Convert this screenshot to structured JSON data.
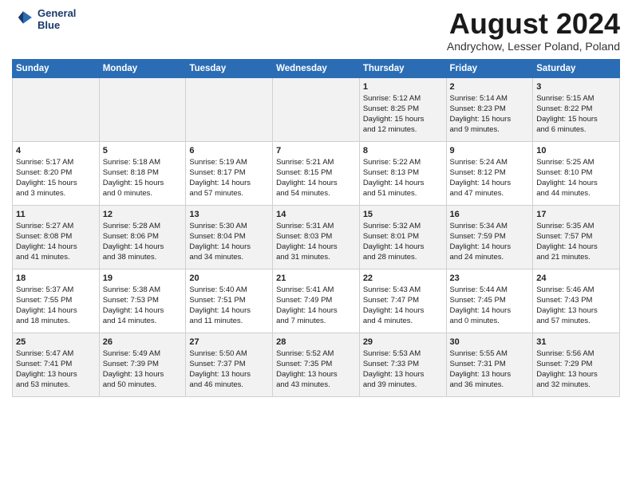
{
  "header": {
    "logo_line1": "General",
    "logo_line2": "Blue",
    "month_title": "August 2024",
    "subtitle": "Andrychow, Lesser Poland, Poland"
  },
  "days_of_week": [
    "Sunday",
    "Monday",
    "Tuesday",
    "Wednesday",
    "Thursday",
    "Friday",
    "Saturday"
  ],
  "weeks": [
    [
      {
        "day": "",
        "info": ""
      },
      {
        "day": "",
        "info": ""
      },
      {
        "day": "",
        "info": ""
      },
      {
        "day": "",
        "info": ""
      },
      {
        "day": "1",
        "info": "Sunrise: 5:12 AM\nSunset: 8:25 PM\nDaylight: 15 hours\nand 12 minutes."
      },
      {
        "day": "2",
        "info": "Sunrise: 5:14 AM\nSunset: 8:23 PM\nDaylight: 15 hours\nand 9 minutes."
      },
      {
        "day": "3",
        "info": "Sunrise: 5:15 AM\nSunset: 8:22 PM\nDaylight: 15 hours\nand 6 minutes."
      }
    ],
    [
      {
        "day": "4",
        "info": "Sunrise: 5:17 AM\nSunset: 8:20 PM\nDaylight: 15 hours\nand 3 minutes."
      },
      {
        "day": "5",
        "info": "Sunrise: 5:18 AM\nSunset: 8:18 PM\nDaylight: 15 hours\nand 0 minutes."
      },
      {
        "day": "6",
        "info": "Sunrise: 5:19 AM\nSunset: 8:17 PM\nDaylight: 14 hours\nand 57 minutes."
      },
      {
        "day": "7",
        "info": "Sunrise: 5:21 AM\nSunset: 8:15 PM\nDaylight: 14 hours\nand 54 minutes."
      },
      {
        "day": "8",
        "info": "Sunrise: 5:22 AM\nSunset: 8:13 PM\nDaylight: 14 hours\nand 51 minutes."
      },
      {
        "day": "9",
        "info": "Sunrise: 5:24 AM\nSunset: 8:12 PM\nDaylight: 14 hours\nand 47 minutes."
      },
      {
        "day": "10",
        "info": "Sunrise: 5:25 AM\nSunset: 8:10 PM\nDaylight: 14 hours\nand 44 minutes."
      }
    ],
    [
      {
        "day": "11",
        "info": "Sunrise: 5:27 AM\nSunset: 8:08 PM\nDaylight: 14 hours\nand 41 minutes."
      },
      {
        "day": "12",
        "info": "Sunrise: 5:28 AM\nSunset: 8:06 PM\nDaylight: 14 hours\nand 38 minutes."
      },
      {
        "day": "13",
        "info": "Sunrise: 5:30 AM\nSunset: 8:04 PM\nDaylight: 14 hours\nand 34 minutes."
      },
      {
        "day": "14",
        "info": "Sunrise: 5:31 AM\nSunset: 8:03 PM\nDaylight: 14 hours\nand 31 minutes."
      },
      {
        "day": "15",
        "info": "Sunrise: 5:32 AM\nSunset: 8:01 PM\nDaylight: 14 hours\nand 28 minutes."
      },
      {
        "day": "16",
        "info": "Sunrise: 5:34 AM\nSunset: 7:59 PM\nDaylight: 14 hours\nand 24 minutes."
      },
      {
        "day": "17",
        "info": "Sunrise: 5:35 AM\nSunset: 7:57 PM\nDaylight: 14 hours\nand 21 minutes."
      }
    ],
    [
      {
        "day": "18",
        "info": "Sunrise: 5:37 AM\nSunset: 7:55 PM\nDaylight: 14 hours\nand 18 minutes."
      },
      {
        "day": "19",
        "info": "Sunrise: 5:38 AM\nSunset: 7:53 PM\nDaylight: 14 hours\nand 14 minutes."
      },
      {
        "day": "20",
        "info": "Sunrise: 5:40 AM\nSunset: 7:51 PM\nDaylight: 14 hours\nand 11 minutes."
      },
      {
        "day": "21",
        "info": "Sunrise: 5:41 AM\nSunset: 7:49 PM\nDaylight: 14 hours\nand 7 minutes."
      },
      {
        "day": "22",
        "info": "Sunrise: 5:43 AM\nSunset: 7:47 PM\nDaylight: 14 hours\nand 4 minutes."
      },
      {
        "day": "23",
        "info": "Sunrise: 5:44 AM\nSunset: 7:45 PM\nDaylight: 14 hours\nand 0 minutes."
      },
      {
        "day": "24",
        "info": "Sunrise: 5:46 AM\nSunset: 7:43 PM\nDaylight: 13 hours\nand 57 minutes."
      }
    ],
    [
      {
        "day": "25",
        "info": "Sunrise: 5:47 AM\nSunset: 7:41 PM\nDaylight: 13 hours\nand 53 minutes."
      },
      {
        "day": "26",
        "info": "Sunrise: 5:49 AM\nSunset: 7:39 PM\nDaylight: 13 hours\nand 50 minutes."
      },
      {
        "day": "27",
        "info": "Sunrise: 5:50 AM\nSunset: 7:37 PM\nDaylight: 13 hours\nand 46 minutes."
      },
      {
        "day": "28",
        "info": "Sunrise: 5:52 AM\nSunset: 7:35 PM\nDaylight: 13 hours\nand 43 minutes."
      },
      {
        "day": "29",
        "info": "Sunrise: 5:53 AM\nSunset: 7:33 PM\nDaylight: 13 hours\nand 39 minutes."
      },
      {
        "day": "30",
        "info": "Sunrise: 5:55 AM\nSunset: 7:31 PM\nDaylight: 13 hours\nand 36 minutes."
      },
      {
        "day": "31",
        "info": "Sunrise: 5:56 AM\nSunset: 7:29 PM\nDaylight: 13 hours\nand 32 minutes."
      }
    ]
  ]
}
